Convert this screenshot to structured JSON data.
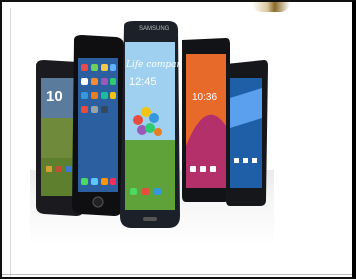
{
  "image": {
    "caption_text": "Life companion",
    "clock_main": "12:45",
    "clock_left": "10",
    "clock_right": "10:36",
    "brand": "SAMSUNG",
    "phones": [
      "htc-phone",
      "iphone",
      "galaxy-s4",
      "sony-xperia",
      "android-phone"
    ],
    "colors": {
      "phone_body": "#1a1d22",
      "screen_blue": "#2a6fb8",
      "grass": "#5fa23a",
      "sky": "#9fd0ef"
    }
  }
}
